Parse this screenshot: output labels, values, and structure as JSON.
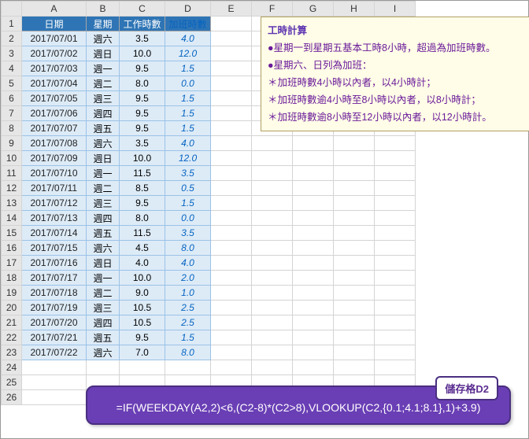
{
  "columns": [
    "A",
    "B",
    "C",
    "D",
    "E",
    "F",
    "G",
    "H",
    "I"
  ],
  "headers": {
    "A": "日期",
    "B": "星期",
    "C": "工作時數",
    "D": "加班時數"
  },
  "rows": [
    {
      "n": 1
    },
    {
      "n": 2,
      "A": "2017/07/01",
      "B": "週六",
      "C": "3.5",
      "D": "4.0"
    },
    {
      "n": 3,
      "A": "2017/07/02",
      "B": "週日",
      "C": "10.0",
      "D": "12.0"
    },
    {
      "n": 4,
      "A": "2017/07/03",
      "B": "週一",
      "C": "9.5",
      "D": "1.5"
    },
    {
      "n": 5,
      "A": "2017/07/04",
      "B": "週二",
      "C": "8.0",
      "D": "0.0"
    },
    {
      "n": 6,
      "A": "2017/07/05",
      "B": "週三",
      "C": "9.5",
      "D": "1.5"
    },
    {
      "n": 7,
      "A": "2017/07/06",
      "B": "週四",
      "C": "9.5",
      "D": "1.5"
    },
    {
      "n": 8,
      "A": "2017/07/07",
      "B": "週五",
      "C": "9.5",
      "D": "1.5"
    },
    {
      "n": 9,
      "A": "2017/07/08",
      "B": "週六",
      "C": "3.5",
      "D": "4.0"
    },
    {
      "n": 10,
      "A": "2017/07/09",
      "B": "週日",
      "C": "10.0",
      "D": "12.0"
    },
    {
      "n": 11,
      "A": "2017/07/10",
      "B": "週一",
      "C": "11.5",
      "D": "3.5"
    },
    {
      "n": 12,
      "A": "2017/07/11",
      "B": "週二",
      "C": "8.5",
      "D": "0.5"
    },
    {
      "n": 13,
      "A": "2017/07/12",
      "B": "週三",
      "C": "9.5",
      "D": "1.5"
    },
    {
      "n": 14,
      "A": "2017/07/13",
      "B": "週四",
      "C": "8.0",
      "D": "0.0"
    },
    {
      "n": 15,
      "A": "2017/07/14",
      "B": "週五",
      "C": "11.5",
      "D": "3.5"
    },
    {
      "n": 16,
      "A": "2017/07/15",
      "B": "週六",
      "C": "4.5",
      "D": "8.0"
    },
    {
      "n": 17,
      "A": "2017/07/16",
      "B": "週日",
      "C": "4.0",
      "D": "4.0"
    },
    {
      "n": 18,
      "A": "2017/07/17",
      "B": "週一",
      "C": "10.0",
      "D": "2.0"
    },
    {
      "n": 19,
      "A": "2017/07/18",
      "B": "週二",
      "C": "9.0",
      "D": "1.0"
    },
    {
      "n": 20,
      "A": "2017/07/19",
      "B": "週三",
      "C": "10.5",
      "D": "2.5"
    },
    {
      "n": 21,
      "A": "2017/07/20",
      "B": "週四",
      "C": "10.5",
      "D": "2.5"
    },
    {
      "n": 22,
      "A": "2017/07/21",
      "B": "週五",
      "C": "9.5",
      "D": "1.5"
    },
    {
      "n": 23,
      "A": "2017/07/22",
      "B": "週六",
      "C": "7.0",
      "D": "8.0"
    },
    {
      "n": 24
    },
    {
      "n": 25
    },
    {
      "n": 26
    }
  ],
  "note": {
    "title": "工時計算",
    "lines": [
      "●星期一到星期五基本工時8小時，超過為加班時數。",
      "●星期六、日列為加班：",
      "＊加班時數4小時以內者，以4小時計；",
      "＊加班時數逾4小時至8小時以內者，以8小時計；",
      "＊加班時數逾8小時至12小時以內者，以12小時計。"
    ]
  },
  "formula": {
    "tag": "儲存格D2",
    "text": "=IF(WEEKDAY(A2,2)<6,(C2-8)*(C2>8),VLOOKUP(C2,{0.1;4.1;8.1},1)+3.9)"
  }
}
